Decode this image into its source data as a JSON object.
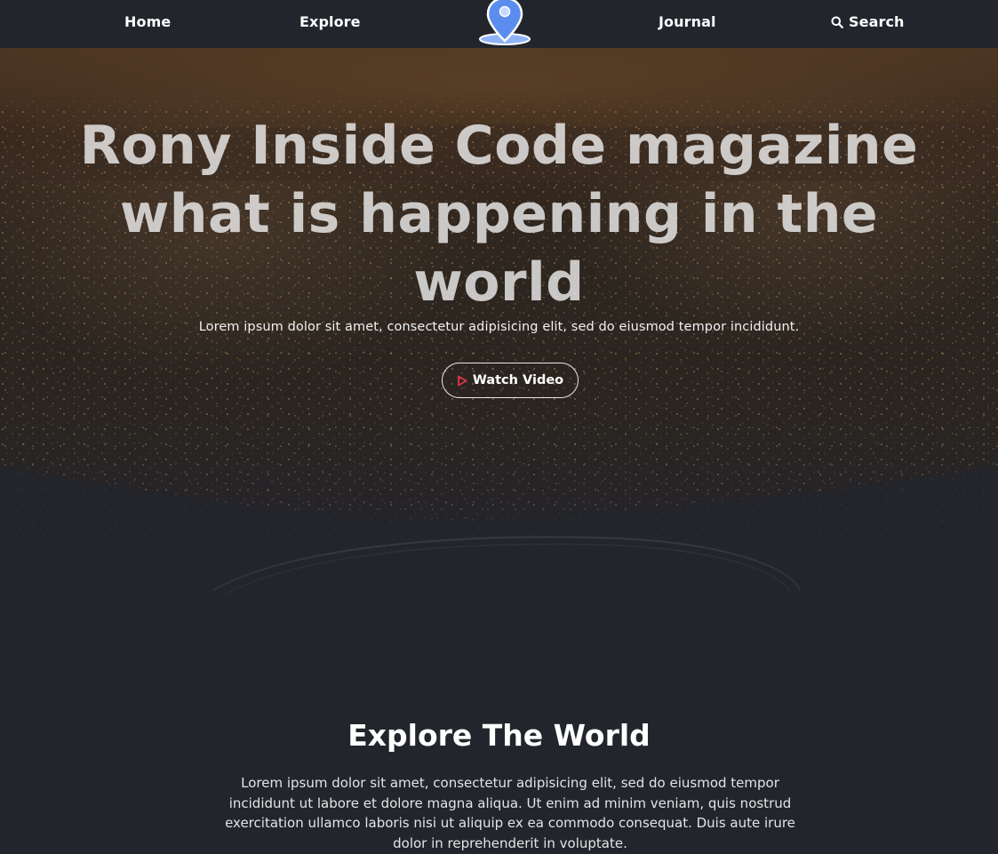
{
  "nav": {
    "home": "Home",
    "explore": "Explore",
    "logo_icon": "map-pin-icon",
    "journal": "Journal",
    "search": "Search",
    "search_icon": "search-icon"
  },
  "hero": {
    "title": "Rony Inside Code magazine what is happening in the world",
    "subtitle": "Lorem ipsum dolor sit amet, consectetur adipisicing elit, sed do eiusmod tempor incididunt.",
    "watch_label": "Watch Video",
    "watch_icon": "play-icon"
  },
  "explore": {
    "title": "Explore The World",
    "text": "Lorem ipsum dolor sit amet, consectetur adipisicing elit, sed do eiusmod tempor incididunt ut labore et dolore magna aliqua. Ut enim ad minim veniam, quis nostrud exercitation ullamco laboris nisi ut aliquip ex ea commodo consequat. Duis aute irure dolor in reprehenderit in voluptate."
  },
  "colors": {
    "nav_bg": "#22252c",
    "page_bg": "#22252c",
    "accent_pin": "#6f9ef5",
    "play_icon": "#e0344b"
  }
}
